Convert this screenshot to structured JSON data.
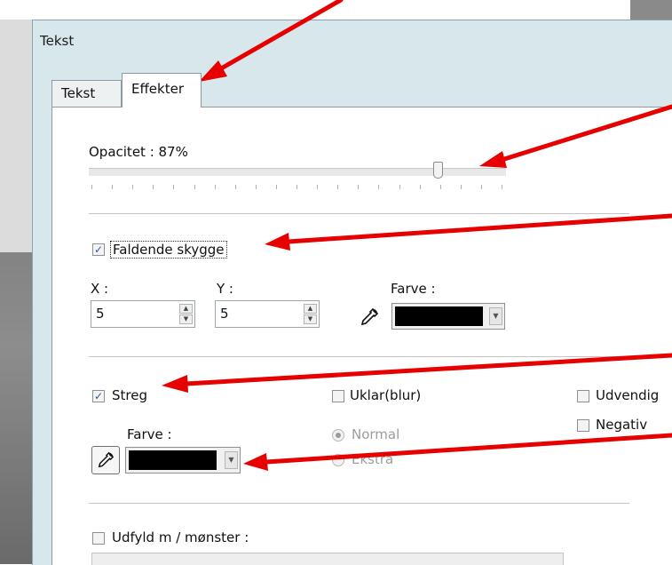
{
  "window": {
    "title": "Tekst"
  },
  "tabs": [
    {
      "label": "Tekst",
      "active": false
    },
    {
      "label": "Effekter",
      "active": true
    }
  ],
  "opacity": {
    "label": "Opacitet : 87%",
    "value_percent": 87
  },
  "drop_shadow": {
    "label": "Faldende skygge",
    "checked": true,
    "x_label": "X :",
    "x_value": "5",
    "y_label": "Y :",
    "y_value": "5",
    "color_label": "Farve :",
    "color": "#000000"
  },
  "stroke": {
    "label": "Streg",
    "checked": true,
    "color_label": "Farve :",
    "color": "#000000"
  },
  "blur": {
    "label": "Uklar(blur)",
    "checked": false,
    "options": [
      {
        "label": "Normal",
        "selected": true
      },
      {
        "label": "Ekstra",
        "selected": false
      }
    ]
  },
  "outer": {
    "label": "Udvendig",
    "checked": false
  },
  "negative": {
    "label": "Negativ",
    "checked": false
  },
  "fill_pattern": {
    "label": "Udfyld m / mønster :",
    "checked": false
  },
  "colors": {
    "annotation_arrow": "#e60000",
    "accent_check": "#2d56a8"
  }
}
